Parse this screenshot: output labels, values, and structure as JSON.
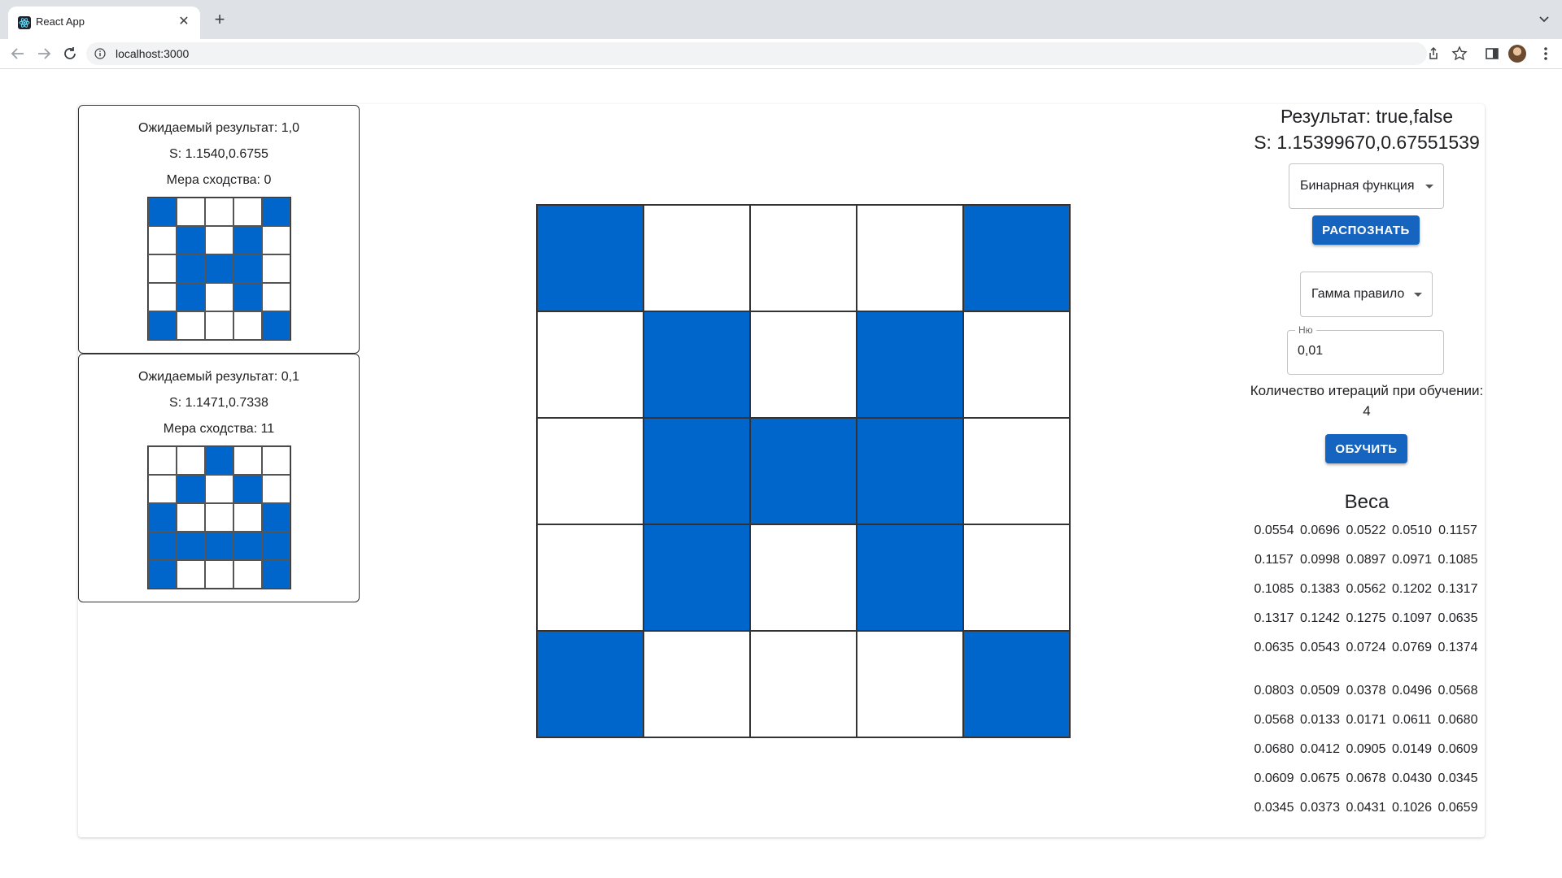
{
  "browser": {
    "tab_title": "React App",
    "url": "localhost:3000"
  },
  "colors": {
    "filled_cell": "#0066cc",
    "button": "#1565c0"
  },
  "samples": [
    {
      "expected": "Ожидаемый результат: 1,0",
      "s": "S: 1.1540,0.6755",
      "similarity": "Мера сходства: 0",
      "grid": [
        [
          1,
          0,
          0,
          0,
          1
        ],
        [
          0,
          1,
          0,
          1,
          0
        ],
        [
          0,
          1,
          1,
          1,
          0
        ],
        [
          0,
          1,
          0,
          1,
          0
        ],
        [
          1,
          0,
          0,
          0,
          1
        ]
      ]
    },
    {
      "expected": "Ожидаемый результат: 0,1",
      "s": "S: 1.1471,0.7338",
      "similarity": "Мера сходства: 11",
      "grid": [
        [
          0,
          0,
          1,
          0,
          0
        ],
        [
          0,
          1,
          0,
          1,
          0
        ],
        [
          1,
          0,
          0,
          0,
          1
        ],
        [
          1,
          1,
          1,
          1,
          1
        ],
        [
          1,
          0,
          0,
          0,
          1
        ]
      ]
    }
  ],
  "main_grid": [
    [
      1,
      0,
      0,
      0,
      1
    ],
    [
      0,
      1,
      0,
      1,
      0
    ],
    [
      0,
      1,
      1,
      1,
      0
    ],
    [
      0,
      1,
      0,
      1,
      0
    ],
    [
      1,
      0,
      0,
      0,
      1
    ]
  ],
  "panel": {
    "result": "Результат: true,false",
    "s_value": "S: 1.15399670,0.67551539",
    "function_select": "Бинарная функция",
    "recognize_button": "РАСПОЗНАТЬ",
    "rule_select": "Гамма правило",
    "nu_label": "Ню",
    "nu_value": "0,01",
    "iterations_label": "Количество итераций при обучении:",
    "iterations_value": "4",
    "train_button": "ОБУЧИТЬ",
    "weights_title": "Веса",
    "weights": [
      [
        [
          "0.0554",
          "0.0696",
          "0.0522",
          "0.0510",
          "0.1157"
        ],
        [
          "0.1157",
          "0.0998",
          "0.0897",
          "0.0971",
          "0.1085"
        ],
        [
          "0.1085",
          "0.1383",
          "0.0562",
          "0.1202",
          "0.1317"
        ],
        [
          "0.1317",
          "0.1242",
          "0.1275",
          "0.1097",
          "0.0635"
        ],
        [
          "0.0635",
          "0.0543",
          "0.0724",
          "0.0769",
          "0.1374"
        ]
      ],
      [
        [
          "0.0803",
          "0.0509",
          "0.0378",
          "0.0496",
          "0.0568"
        ],
        [
          "0.0568",
          "0.0133",
          "0.0171",
          "0.0611",
          "0.0680"
        ],
        [
          "0.0680",
          "0.0412",
          "0.0905",
          "0.0149",
          "0.0609"
        ],
        [
          "0.0609",
          "0.0675",
          "0.0678",
          "0.0430",
          "0.0345"
        ],
        [
          "0.0345",
          "0.0373",
          "0.0431",
          "0.1026",
          "0.0659"
        ]
      ]
    ]
  }
}
